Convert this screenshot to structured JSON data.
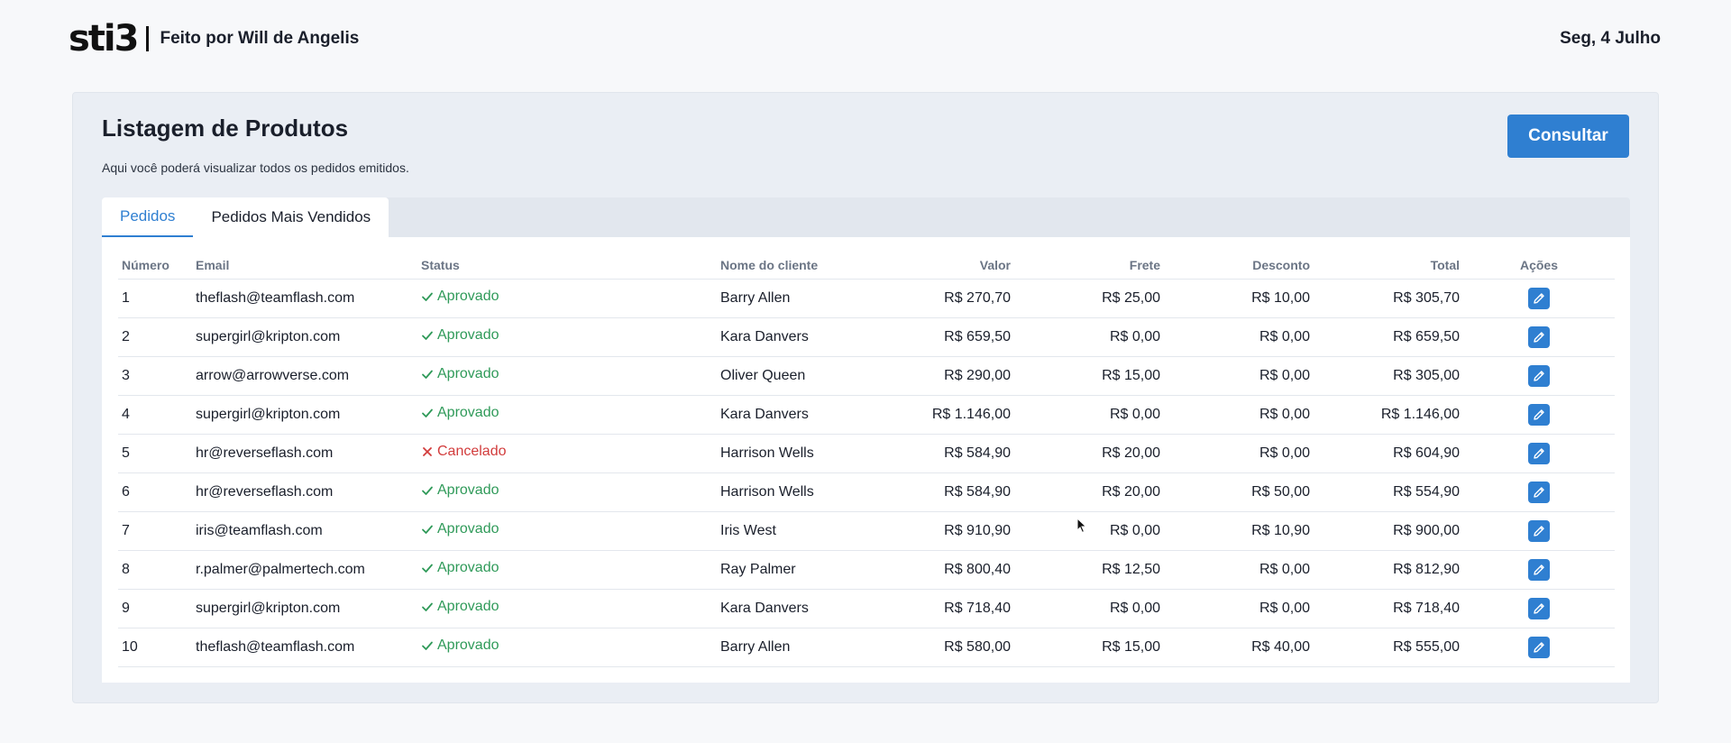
{
  "header": {
    "logo_text": "sti3",
    "credit": "Feito por Will de Angelis",
    "date": "Seg, 4 Julho"
  },
  "panel": {
    "title": "Listagem de Produtos",
    "subtitle": "Aqui você poderá visualizar todos os pedidos emitidos.",
    "consult_label": "Consultar"
  },
  "tabs": [
    {
      "label": "Pedidos",
      "active": true
    },
    {
      "label": "Pedidos Mais Vendidos",
      "active": false
    }
  ],
  "table": {
    "columns": [
      "Número",
      "Email",
      "Status",
      "Nome do cliente",
      "Valor",
      "Frete",
      "Desconto",
      "Total",
      "Ações"
    ],
    "rows": [
      {
        "numero": "1",
        "email": "theflash@teamflash.com",
        "status": "Aprovado",
        "status_kind": "approved",
        "cliente": "Barry Allen",
        "valor": "R$ 270,70",
        "frete": "R$ 25,00",
        "desconto": "R$ 10,00",
        "total": "R$ 305,70"
      },
      {
        "numero": "2",
        "email": "supergirl@kripton.com",
        "status": "Aprovado",
        "status_kind": "approved",
        "cliente": "Kara Danvers",
        "valor": "R$ 659,50",
        "frete": "R$ 0,00",
        "desconto": "R$ 0,00",
        "total": "R$ 659,50"
      },
      {
        "numero": "3",
        "email": "arrow@arrowverse.com",
        "status": "Aprovado",
        "status_kind": "approved",
        "cliente": "Oliver Queen",
        "valor": "R$ 290,00",
        "frete": "R$ 15,00",
        "desconto": "R$ 0,00",
        "total": "R$ 305,00"
      },
      {
        "numero": "4",
        "email": "supergirl@kripton.com",
        "status": "Aprovado",
        "status_kind": "approved",
        "cliente": "Kara Danvers",
        "valor": "R$ 1.146,00",
        "frete": "R$ 0,00",
        "desconto": "R$ 0,00",
        "total": "R$ 1.146,00"
      },
      {
        "numero": "5",
        "email": "hr@reverseflash.com",
        "status": "Cancelado",
        "status_kind": "cancelled",
        "cliente": "Harrison Wells",
        "valor": "R$ 584,90",
        "frete": "R$ 20,00",
        "desconto": "R$ 0,00",
        "total": "R$ 604,90"
      },
      {
        "numero": "6",
        "email": "hr@reverseflash.com",
        "status": "Aprovado",
        "status_kind": "approved",
        "cliente": "Harrison Wells",
        "valor": "R$ 584,90",
        "frete": "R$ 20,00",
        "desconto": "R$ 50,00",
        "total": "R$ 554,90"
      },
      {
        "numero": "7",
        "email": "iris@teamflash.com",
        "status": "Aprovado",
        "status_kind": "approved",
        "cliente": "Iris West",
        "valor": "R$ 910,90",
        "frete": "R$ 0,00",
        "desconto": "R$ 10,90",
        "total": "R$ 900,00"
      },
      {
        "numero": "8",
        "email": "r.palmer@palmertech.com",
        "status": "Aprovado",
        "status_kind": "approved",
        "cliente": "Ray Palmer",
        "valor": "R$ 800,40",
        "frete": "R$ 12,50",
        "desconto": "R$ 0,00",
        "total": "R$ 812,90"
      },
      {
        "numero": "9",
        "email": "supergirl@kripton.com",
        "status": "Aprovado",
        "status_kind": "approved",
        "cliente": "Kara Danvers",
        "valor": "R$ 718,40",
        "frete": "R$ 0,00",
        "desconto": "R$ 0,00",
        "total": "R$ 718,40"
      },
      {
        "numero": "10",
        "email": "theflash@teamflash.com",
        "status": "Aprovado",
        "status_kind": "approved",
        "cliente": "Barry Allen",
        "valor": "R$ 580,00",
        "frete": "R$ 15,00",
        "desconto": "R$ 40,00",
        "total": "R$ 555,00"
      }
    ],
    "action_icon": "pencil-icon"
  },
  "colors": {
    "accent": "#2f7fd1",
    "approved": "#2f9a59",
    "cancelled": "#d23c3c"
  }
}
